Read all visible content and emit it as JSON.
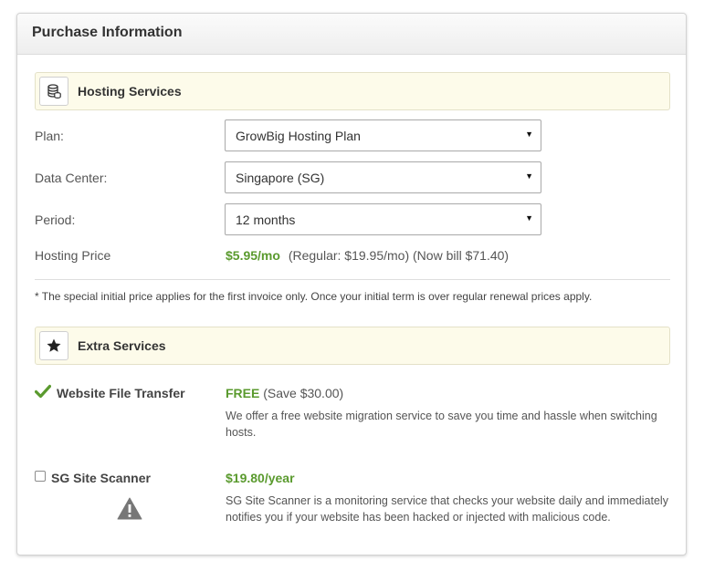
{
  "panel": {
    "title": "Purchase Information"
  },
  "hosting": {
    "section_title": "Hosting Services",
    "icon": "database-icon",
    "plan": {
      "label": "Plan:",
      "value": "GrowBig Hosting Plan"
    },
    "data_center": {
      "label": "Data Center:",
      "value": "Singapore (SG)"
    },
    "period": {
      "label": "Period:",
      "value": "12 months"
    },
    "price": {
      "label": "Hosting Price",
      "amount": "$5.95/mo",
      "regular": "(Regular: $19.95/mo)",
      "now_bill": "(Now bill $71.40)"
    },
    "note": "* The special initial price applies for the first invoice only. Once your initial term is over regular renewal prices apply."
  },
  "extra": {
    "section_title": "Extra Services",
    "icon": "star-icon",
    "transfer": {
      "name": "Website File Transfer",
      "price": "FREE",
      "save": "(Save $30.00)",
      "description": "We offer a free website migration service to save you time and hassle when switching hosts."
    },
    "scanner": {
      "name": "SG Site Scanner",
      "price": "$19.80/year",
      "description": "SG Site Scanner is a monitoring service that checks your website daily and immediately notifies you if your website has been hacked or injected with malicious code."
    }
  },
  "colors": {
    "accent_green": "#5a9a2e",
    "section_bg": "#fdfbea"
  }
}
